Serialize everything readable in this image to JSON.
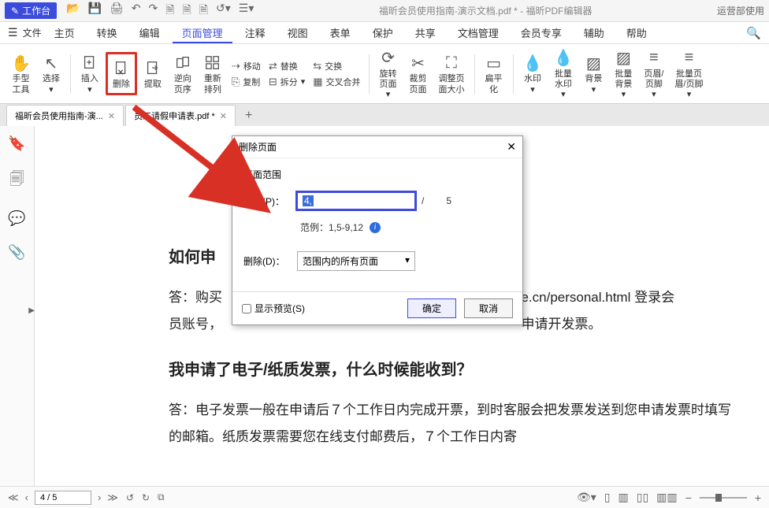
{
  "titlebar": {
    "workbench": "工作台",
    "title": "福昕会员使用指南-演示文档.pdf * - 福昕PDF编辑器",
    "right": "运营部使用"
  },
  "menubar": {
    "file": "文件",
    "items": [
      "主页",
      "转换",
      "编辑",
      "页面管理",
      "注释",
      "视图",
      "表单",
      "保护",
      "共享",
      "文档管理",
      "会员专享",
      "辅助",
      "帮助"
    ],
    "active_index": 3
  },
  "ribbon": {
    "hand": "手型\n工具",
    "select": "选择",
    "insert": "插入",
    "delete": "删除",
    "extract": "提取",
    "reverse": "逆向\n页序",
    "rearrange": "重新\n排列",
    "move": "移动",
    "copy": "复制",
    "replace": "替换",
    "split": "拆分",
    "swap": "交换",
    "merge": "交叉合并",
    "rotate": "旋转\n页面",
    "crop": "裁剪\n页面",
    "resize": "调整页\n面大小",
    "flatten": "扁平\n化",
    "watermark": "水印",
    "batch_wm": "批量\n水印",
    "background": "背景",
    "batch_bg": "批量\n背景",
    "header": "页眉/\n页脚",
    "batch_hf": "批量页\n眉/页脚"
  },
  "tabs": {
    "t1": "福昕会员使用指南-演...",
    "t2": "员工请假申请表.pdf *"
  },
  "dialog": {
    "title": "删除页面",
    "range_label": "页面范围",
    "page_label": "页面(P)：",
    "page_value": "4,",
    "slash": "/",
    "total": "5",
    "example_label": "范例：1,5-9,12",
    "delete_label": "删除(D)：",
    "delete_option": "范围内的所有页面",
    "preview": "显示预览(S)",
    "ok": "确定",
    "cancel": "取消"
  },
  "document": {
    "h1": "如何申",
    "p1a": "答：购买",
    "p1b": "e.cn/personal.html 登录会",
    "p1c": "员账号，",
    "p1d": "申请开发票。",
    "h2": "我申请了电子/纸质发票，什么时候能收到？",
    "p2": "答：电子发票一般在申请后７个工作日内完成开票，到时客服会把发票发送到您申请发票时填写的邮箱。纸质发票需要您在线支付邮费后，７个工作日内寄"
  },
  "statusbar": {
    "page": "4 / 5"
  }
}
